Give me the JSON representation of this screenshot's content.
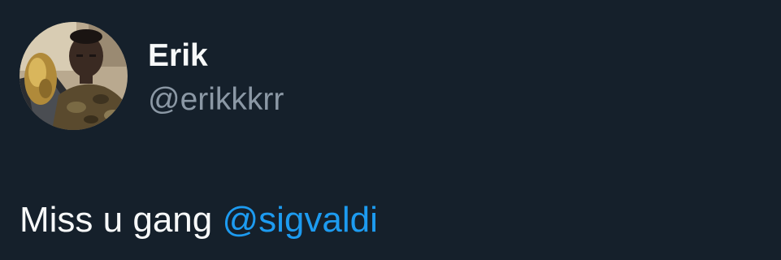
{
  "author": {
    "display_name": "Erik",
    "handle": "@erikkkrr",
    "avatar_icon": "profile-photo"
  },
  "tweet": {
    "text_prefix": "Miss u gang",
    "mention": "@sigvaldi"
  },
  "colors": {
    "background": "#15202b",
    "name": "#f7f9f9",
    "handle": "#8b98a5",
    "mention": "#1d9bf0"
  }
}
